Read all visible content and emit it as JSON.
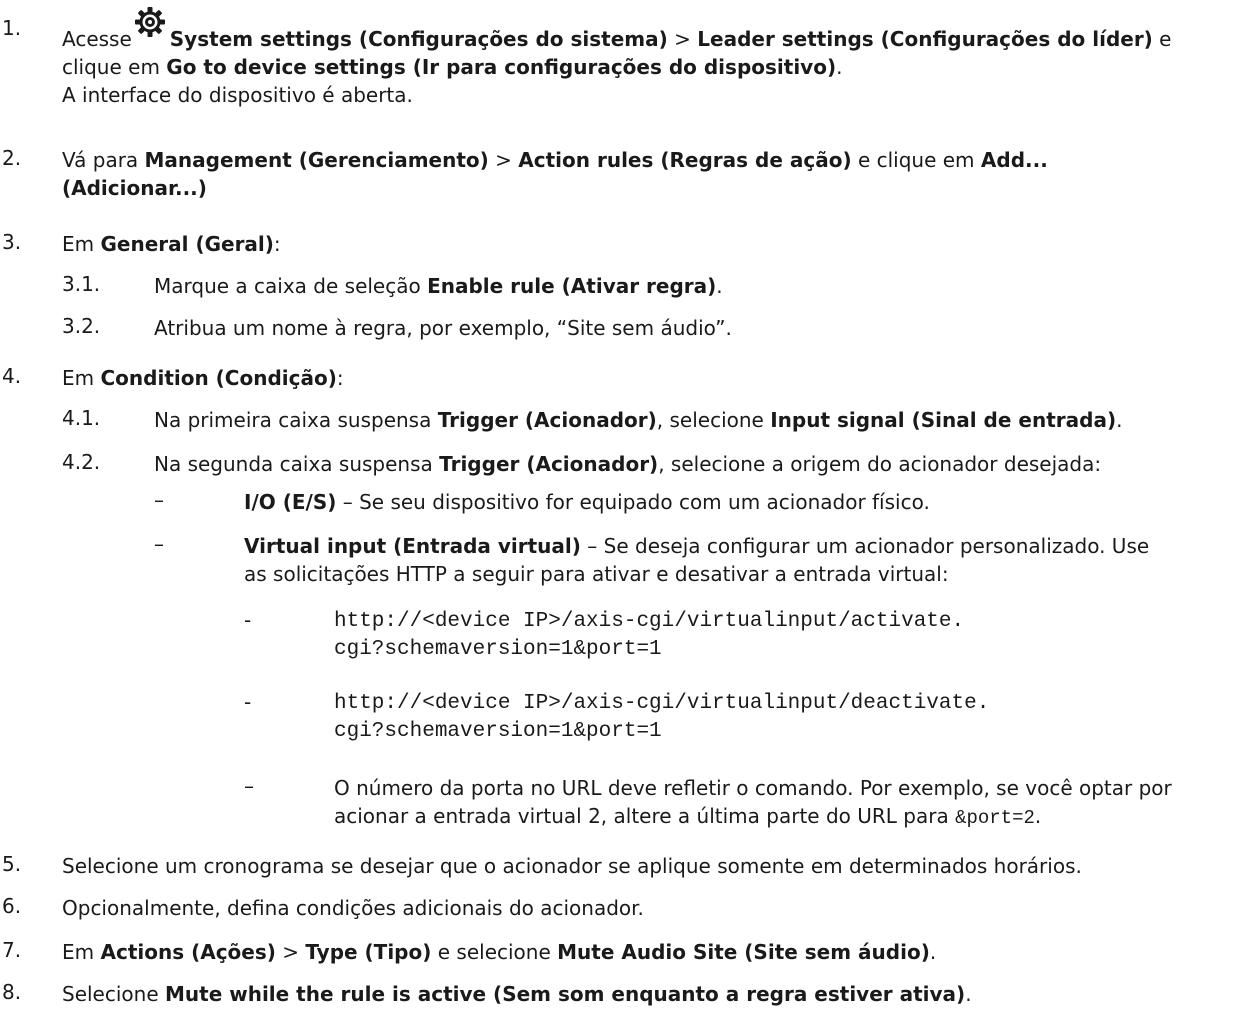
{
  "steps": {
    "s1": {
      "num": "1.",
      "pre": "Acesse",
      "b1": "System settings (Configurações do sistema)",
      "sep1": " > ",
      "b2": "Leader settings (Configurações do líder)",
      "mid": " e clique em ",
      "b3": "Go to device settings (Ir para configurações do dispositivo)",
      "end": ".",
      "line3": "A interface do dispositivo é aberta."
    },
    "s2": {
      "num": "2.",
      "pre": "Vá para ",
      "b1": "Management (Gerenciamento)",
      "sep1": " > ",
      "b2": "Action rules (Regras de ação)",
      "mid": " e clique em ",
      "b3": "Add... (Adicionar...)"
    },
    "s3": {
      "num": "3.",
      "pre": "Em ",
      "b1": "General (Geral)",
      "end": ":",
      "sub1": {
        "num": "3.1.",
        "pre": "Marque a caixa de seleção ",
        "b1": "Enable rule (Ativar regra)",
        "end": "."
      },
      "sub2": {
        "num": "3.2.",
        "text": "Atribua um nome à regra, por exemplo, “Site sem áudio”."
      }
    },
    "s4": {
      "num": "4.",
      "pre": "Em ",
      "b1": "Condition (Condição)",
      "end": ":",
      "sub1": {
        "num": "4.1.",
        "pre": "Na primeira caixa suspensa ",
        "b1": "Trigger (Acionador)",
        "mid": ", selecione ",
        "b2": "Input signal (Sinal de entrada)",
        "end": "."
      },
      "sub2": {
        "num": "4.2.",
        "pre": "Na segunda caixa suspensa ",
        "b1": "Trigger (Acionador)",
        "end": ", selecione a origem do acionador desejada:"
      },
      "bullet1": {
        "dash": "–",
        "b1": "I/O (E/S)",
        "text": " – Se seu dispositivo for equipado com um acionador físico."
      },
      "bullet2": {
        "dash": "–",
        "b1": "Virtual input (Entrada virtual)",
        "text": " – Se deseja configurar um acionador personalizado. Use as solicitações HTTP a seguir para ativar e desativar a entrada virtual:"
      },
      "url1": {
        "dash": "-",
        "l1": "http://<device IP>/axis-cgi/virtualinput/activate.",
        "l2": "cgi?schemaversion=1&port=1"
      },
      "url2": {
        "dash": "-",
        "l1": "http://<device IP>/axis-cgi/virtualinput/deactivate.",
        "l2": "cgi?schemaversion=1&port=1"
      },
      "note": {
        "dash": "–",
        "text": "O número da porta no URL deve refletir o comando. Por exemplo, se você optar por acionar a entrada virtual 2, altere a última parte do URL para ",
        "code": "&port=2",
        "end": "."
      }
    },
    "s5": {
      "num": "5.",
      "text": "Selecione um cronograma se desejar que o acionador se aplique somente em determinados horários."
    },
    "s6": {
      "num": "6.",
      "text": "Opcionalmente, defina condições adicionais do acionador."
    },
    "s7": {
      "num": "7.",
      "pre": "Em ",
      "b1": "Actions (Ações)",
      "sep1": " > ",
      "b2": "Type (Tipo)",
      "mid": " e selecione ",
      "b3": "Mute Audio Site (Site sem áudio)",
      "end": "."
    },
    "s8": {
      "num": "8.",
      "pre": "Selecione ",
      "b1": "Mute while the rule is active (Sem som enquanto a regra estiver ativa)",
      "end": "."
    }
  },
  "icons": {
    "settings": "gear-icon"
  }
}
